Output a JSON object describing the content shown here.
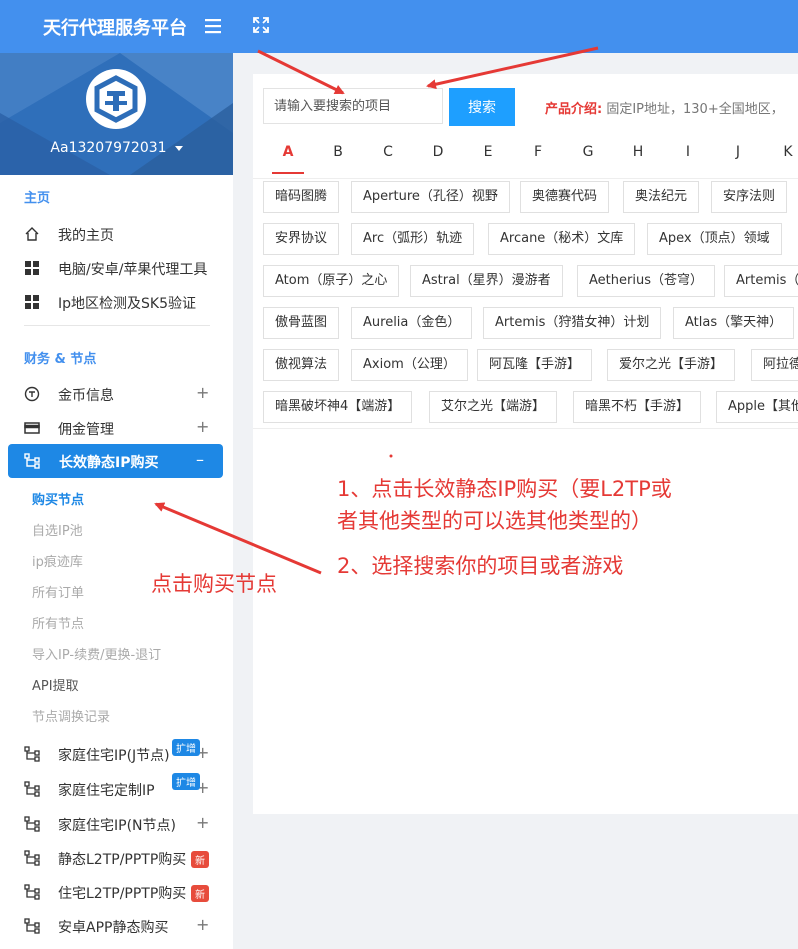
{
  "app": {
    "title": "天行代理服务平台"
  },
  "user": {
    "name": "Aa13207972031"
  },
  "sidebar": {
    "section_main": "主页",
    "main_items": [
      {
        "label": "我的主页",
        "icon": "home-icon"
      },
      {
        "label": "电脑/安卓/苹果代理工具",
        "icon": "grid-icon"
      },
      {
        "label": "Ip地区检测及SK5验证",
        "icon": "grid-icon"
      }
    ],
    "section_finance": "财务 & 节点",
    "finance_items": [
      {
        "label": "金币信息",
        "icon": "coin-icon",
        "expand": "+"
      },
      {
        "label": "佣金管理",
        "icon": "card-icon",
        "expand": "+"
      }
    ],
    "active_item": {
      "label": "长效静态IP购买",
      "collapse": "–"
    },
    "sub_items": [
      "购买节点",
      "自选IP池",
      "ip痕迹库",
      "所有订单",
      "所有节点",
      "导入IP-续费/更换-退订",
      "API提取",
      "节点调换记录"
    ],
    "more_items": [
      {
        "label": "家庭住宅IP(J节点)",
        "tag": "扩增",
        "expand": "+"
      },
      {
        "label": "家庭住宅定制IP",
        "tag": "扩增",
        "expand": "+"
      },
      {
        "label": "家庭住宅IP(N节点)",
        "expand": "+"
      },
      {
        "label": "静态L2TP/PPTP购买",
        "tag": "新"
      },
      {
        "label": "住宅L2TP/PPTP购买",
        "tag": "新"
      },
      {
        "label": "安卓APP静态购买",
        "expand": "+"
      }
    ]
  },
  "search": {
    "placeholder": "请输入要搜索的项目",
    "button": "搜索"
  },
  "intro": {
    "label": "产品介绍:",
    "text": "固定IP地址，130+全国地区，"
  },
  "letters": [
    "A",
    "B",
    "C",
    "D",
    "E",
    "F",
    "G",
    "H",
    "I",
    "J",
    "K"
  ],
  "chips": [
    [
      "暗码图腾",
      "Aperture（孔径）视野",
      "奥德赛代码",
      "奥法纪元",
      "安序法则"
    ],
    [
      "安界协议",
      "Arc（弧形）轨迹",
      "Arcane（秘术）文库",
      "Apex（顶点）领域"
    ],
    [
      "Atom（原子）之心",
      "Astral（星界）漫游者",
      "Aetherius（苍穹）",
      "Artemis（"
    ],
    [
      "傲骨蓝图",
      "Aurelia（金色）",
      "Artemis（狩猎女神）计划",
      "Atlas（擎天神）"
    ],
    [
      "傲视算法",
      "Axiom（公理）",
      "阿瓦隆【手游】",
      "爱尔之光【手游】",
      "阿拉德"
    ],
    [
      "暗黑破坏神4【端游】",
      "艾尔之光【端游】",
      "暗黑不朽【手游】",
      "Apple【其他"
    ]
  ],
  "annotations": {
    "step1_line1": "1、点击长效静态IP购买（要L2TP或",
    "step1_line2": "者其他类型的可以选其他类型的）",
    "step2": "2、选择搜索你的项目或者游戏",
    "buy_node": "点击购买节点"
  },
  "colors": {
    "topbar": "#4390ee",
    "accent": "#1e88e5",
    "annotation": "#e53935"
  }
}
